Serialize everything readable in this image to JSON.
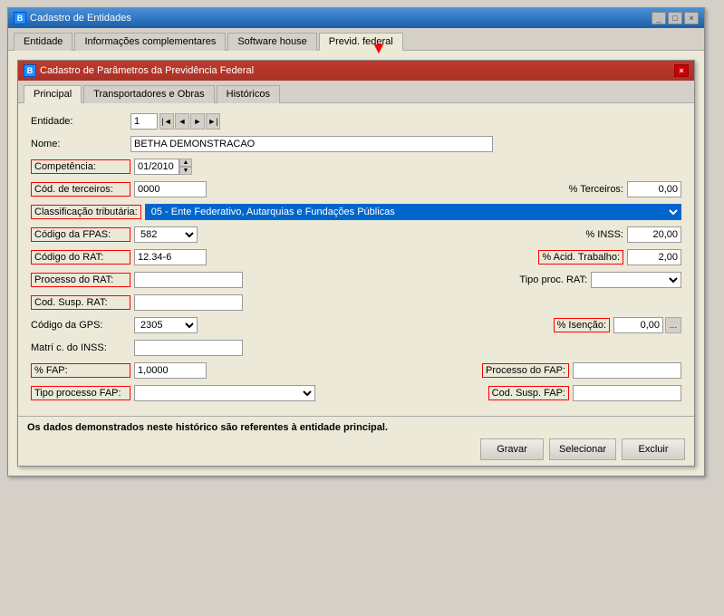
{
  "outerWindow": {
    "title": "Cadastro de Entidades",
    "icon": "B",
    "tabs": [
      {
        "label": "Entidade",
        "active": false
      },
      {
        "label": "Informações complementares",
        "active": false
      },
      {
        "label": "Software house",
        "active": false
      },
      {
        "label": "Previd. federal",
        "active": true
      }
    ]
  },
  "innerWindow": {
    "title": "Cadastro de Parâmetros da Previdência Federal",
    "icon": "B",
    "tabs": [
      {
        "label": "Principal",
        "active": true
      },
      {
        "label": "Transportadores e Obras",
        "active": false
      },
      {
        "label": "Históricos",
        "active": false
      }
    ]
  },
  "form": {
    "entidade_label": "Entidade:",
    "entidade_value": "1",
    "nome_label": "Nome:",
    "nome_value": "BETHA DEMONSTRACAO",
    "competencia_label": "Competência:",
    "competencia_value": "01/2010",
    "cod_terceiros_label": "Cód. de terceiros:",
    "cod_terceiros_value": "0000",
    "perc_terceiros_label": "% Terceiros:",
    "perc_terceiros_value": "0,00",
    "class_trib_label": "Classificação tributária:",
    "class_trib_value": "05 - Ente Federativo, Autarquias e Fundações Públicas",
    "cod_fpas_label": "Código da FPAS:",
    "cod_fpas_value": "582",
    "perc_inss_label": "% INSS:",
    "perc_inss_value": "20,00",
    "cod_rat_label": "Código do RAT:",
    "cod_rat_value": "12.34-6",
    "perc_acid_trab_label": "% Acid. Trabalho:",
    "perc_acid_trab_value": "2,00",
    "processo_rat_label": "Processo do RAT:",
    "processo_rat_value": "",
    "tipo_proc_rat_label": "Tipo proc. RAT:",
    "tipo_proc_rat_value": "",
    "cod_susp_rat_label": "Cod. Susp. RAT:",
    "cod_susp_rat_value": "",
    "cod_gps_label": "Código da GPS:",
    "cod_gps_value": "2305",
    "perc_isencao_label": "% Isenção:",
    "perc_isencao_value": "0,00",
    "matric_inss_label": "Matrí c. do INSS:",
    "matric_inss_value": "",
    "perc_fap_label": "% FAP:",
    "perc_fap_value": "1,0000",
    "processo_fap_label": "Processo do FAP:",
    "processo_fap_value": "",
    "tipo_proc_fap_label": "Tipo processo FAP:",
    "tipo_proc_fap_value": "",
    "cod_susp_fap_label": "Cod. Susp. FAP:",
    "cod_susp_fap_value": ""
  },
  "bottom": {
    "note": "Os dados demonstrados neste histórico são referentes à entidade principal.",
    "btn_gravar": "Gravar",
    "btn_selecionar": "Selecionar",
    "btn_excluir": "Excluir"
  }
}
